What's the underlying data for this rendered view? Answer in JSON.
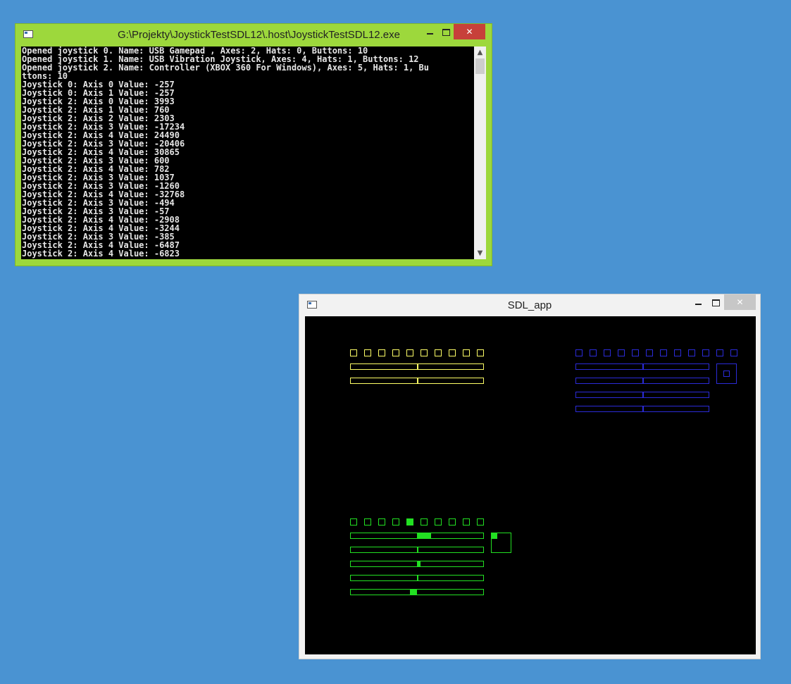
{
  "console": {
    "title": "G:\\Projekty\\JoystickTestSDL12\\.host\\JoystickTestSDL12.exe",
    "lines": [
      "Opened joystick 0. Name: USB Gamepad , Axes: 2, Hats: 0, Buttons: 10",
      "Opened joystick 1. Name: USB Vibration Joystick, Axes: 4, Hats: 1, Buttons: 12",
      "Opened joystick 2. Name: Controller (XBOX 360 For Windows), Axes: 5, Hats: 1, Bu",
      "ttons: 10",
      "Joystick 0: Axis 0 Value: -257",
      "Joystick 0: Axis 1 Value: -257",
      "Joystick 2: Axis 0 Value: 3993",
      "Joystick 2: Axis 1 Value: 760",
      "Joystick 2: Axis 2 Value: 2303",
      "Joystick 2: Axis 3 Value: -17234",
      "Joystick 2: Axis 4 Value: 24490",
      "Joystick 2: Axis 3 Value: -20406",
      "Joystick 2: Axis 4 Value: 30865",
      "Joystick 2: Axis 3 Value: 600",
      "Joystick 2: Axis 4 Value: 782",
      "Joystick 2: Axis 3 Value: 1037",
      "Joystick 2: Axis 3 Value: -1260",
      "Joystick 2: Axis 4 Value: -32768",
      "Joystick 2: Axis 3 Value: -494",
      "Joystick 2: Axis 3 Value: -57",
      "Joystick 2: Axis 4 Value: -2908",
      "Joystick 2: Axis 4 Value: -3244",
      "Joystick 2: Axis 3 Value: -385",
      "Joystick 2: Axis 4 Value: -6487",
      "Joystick 2: Axis 4 Value: -6823"
    ]
  },
  "sdl": {
    "title": "SDL_app",
    "joysticks": [
      {
        "color": "#ffff66",
        "buttons_pressed": [
          false,
          false,
          false,
          false,
          false,
          false,
          false,
          false,
          false,
          false
        ],
        "axes": [
          0,
          0
        ],
        "hat": null
      },
      {
        "color": "#2b2bd8",
        "buttons_pressed": [
          false,
          false,
          false,
          false,
          false,
          false,
          false,
          false,
          false,
          false,
          false,
          false
        ],
        "axes": [
          0,
          0,
          0,
          0
        ],
        "hat": "centered"
      },
      {
        "color": "#22e022",
        "buttons_pressed": [
          false,
          false,
          false,
          false,
          true,
          false,
          false,
          false,
          false,
          false
        ],
        "axes": [
          0.2,
          0.0,
          0.04,
          0.0,
          -0.1
        ],
        "hat": "up-left"
      }
    ]
  },
  "icons": {
    "console_app": "console-window-icon",
    "sdl_app": "sdl-window-icon"
  }
}
